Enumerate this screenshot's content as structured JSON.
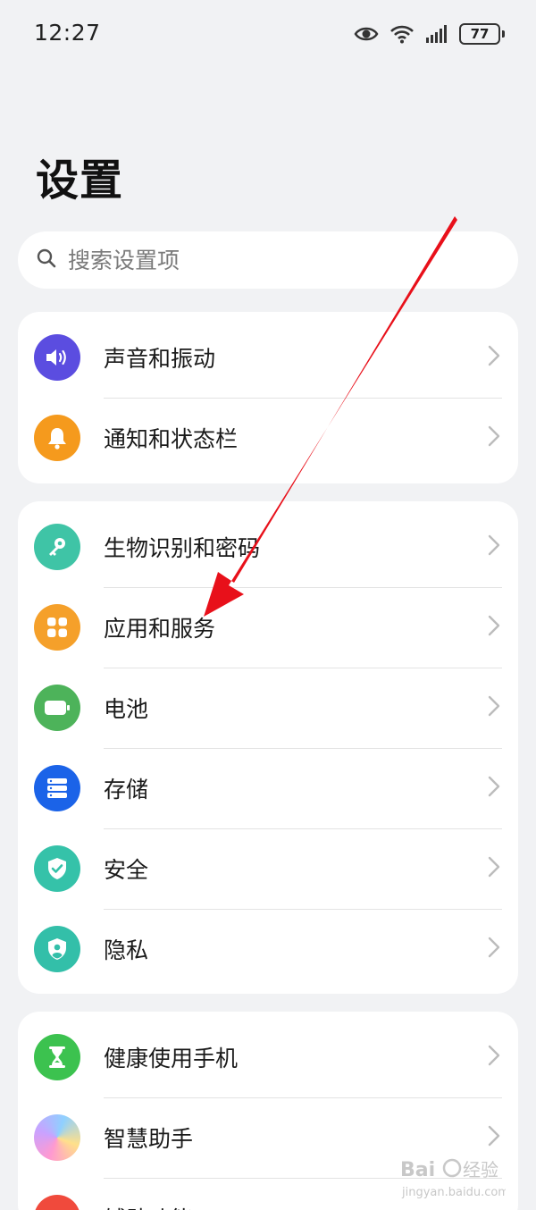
{
  "status_bar": {
    "time": "12:27",
    "battery": "77"
  },
  "page": {
    "title": "设置"
  },
  "search": {
    "placeholder": "搜索设置项"
  },
  "groups": [
    {
      "items": [
        {
          "label": "声音和振动",
          "icon": "speaker-icon",
          "color": "#5b4de0"
        },
        {
          "label": "通知和状态栏",
          "icon": "bell-icon",
          "color": "#f59a1d"
        }
      ]
    },
    {
      "items": [
        {
          "label": "生物识别和密码",
          "icon": "key-icon",
          "color": "#3fc4a6"
        },
        {
          "label": "应用和服务",
          "icon": "apps-grid-icon",
          "color": "#f5a02a"
        },
        {
          "label": "电池",
          "icon": "battery-icon",
          "color": "#4db35a"
        },
        {
          "label": "存储",
          "icon": "storage-icon",
          "color": "#1b63e8"
        },
        {
          "label": "安全",
          "icon": "shield-check-icon",
          "color": "#35c2a9"
        },
        {
          "label": "隐私",
          "icon": "privacy-shield-icon",
          "color": "#33bfa9"
        }
      ]
    },
    {
      "items": [
        {
          "label": "健康使用手机",
          "icon": "hourglass-icon",
          "color": "#3cc24f"
        },
        {
          "label": "智慧助手",
          "icon": "assistant-icon",
          "color": "#c9a2ff"
        },
        {
          "label": "辅助功能",
          "icon": "accessibility-icon",
          "color": "#f04a3c"
        }
      ]
    }
  ],
  "annotation": {
    "arrow_color": "#e8101a"
  }
}
